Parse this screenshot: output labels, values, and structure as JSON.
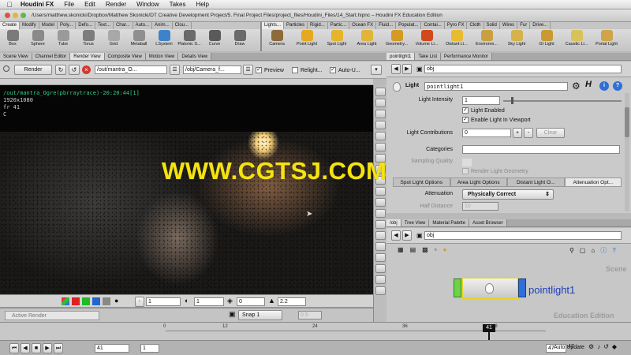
{
  "menubar": {
    "app": "Houdini FX",
    "items": [
      "File",
      "Edit",
      "Render",
      "Window",
      "Takes",
      "Help"
    ],
    "title": "/Users/matthew.skonicki/Dropbox/Matthew Skonicki/DT Creative Development Project/5. Final Project Files/project_files/Houdini_Files/14_Start.hipnc – Houdini FX Education Edition"
  },
  "shelf_left": {
    "tabs": [
      "Create",
      "Modify",
      "Model",
      "Poly...",
      "Defo...",
      "Text...",
      "Char...",
      "Auto...",
      "Anim...",
      "Clou..."
    ],
    "tools": [
      {
        "label": "Box",
        "color": "#7a7a7a"
      },
      {
        "label": "Sphere",
        "color": "#8a8a8a"
      },
      {
        "label": "Tube",
        "color": "#9a9a9a"
      },
      {
        "label": "Torus",
        "color": "#7d7d7d"
      },
      {
        "label": "Grid",
        "color": "#a8a8a8"
      },
      {
        "label": "Metaball",
        "color": "#8f8f8f"
      },
      {
        "label": "LSystem",
        "color": "#3d83c9"
      },
      {
        "label": "Platonic S...",
        "color": "#6a6a6a"
      },
      {
        "label": "Curve",
        "color": "#5a5a5a"
      },
      {
        "label": "Draw",
        "color": "#6a6a6a"
      }
    ]
  },
  "shelf_right": {
    "tabs": [
      "Lights...",
      "Particles",
      "Rigid...",
      "Partic...",
      "Ocean FX",
      "Fluid...",
      "Populat...",
      "Contai...",
      "Pyro FX",
      "Cloth",
      "Solid",
      "Wires",
      "Fur",
      "Drive..."
    ],
    "tools": [
      {
        "label": "Camera",
        "color": "#8c6a3a"
      },
      {
        "label": "Point Light",
        "color": "#e6a81e"
      },
      {
        "label": "Spot Light",
        "color": "#e6b42a"
      },
      {
        "label": "Area Light",
        "color": "#e2b538"
      },
      {
        "label": "Geometry...",
        "color": "#d59a24"
      },
      {
        "label": "Volume Li...",
        "color": "#d24a1c"
      },
      {
        "label": "Distant Li...",
        "color": "#e8bb30"
      },
      {
        "label": "Environm...",
        "color": "#c9a040"
      },
      {
        "label": "Sky Light",
        "color": "#d6b24c"
      },
      {
        "label": "GI Light",
        "color": "#c99a30"
      },
      {
        "label": "Caustic Li...",
        "color": "#d9c25a"
      },
      {
        "label": "Portal Light",
        "color": "#cfa44a"
      }
    ]
  },
  "left_pane": {
    "tabs": [
      "Scene View",
      "Channel Editor",
      "Render View",
      "Composite View",
      "Motion View",
      "Details View"
    ],
    "active_tab": "Render View",
    "toolbar": {
      "render_label": "Render",
      "rop_path": "/out/mantra_O...",
      "camera_path": "/obj/Camera_f...",
      "preview_label": "Preview",
      "relight_label": "Relight...",
      "auto_update_label": "Auto-U..."
    },
    "viewer": {
      "line1": "/out/mantra_Ogre(pbrraytrace)-20:20:44[1]",
      "line2": "1920x1080",
      "line3": "fr 41",
      "line4": "C"
    },
    "bottom_bar": {
      "field1": "1",
      "field2": "1",
      "field3": "0",
      "field4": "2.2",
      "active_render": "Active Render",
      "snap_label": "Snap",
      "snap_value": "1",
      "dim_value": "0.5"
    }
  },
  "param_pane": {
    "tabs": [
      "pointlight1",
      "Take List",
      "Performance Monitor"
    ],
    "path": "obj",
    "node_type": "Light",
    "node_name": "pointlight1",
    "params": {
      "light_intensity_label": "Light Intensity",
      "light_intensity": "1",
      "light_enabled_label": "Light Enabled",
      "enable_viewport_label": "Enable Light In Viewport",
      "light_contributions_label": "Light Contributions",
      "light_contributions": "0",
      "clear_label": "Clear",
      "categories_label": "Categories",
      "sampling_quality_label": "Sampling Quality",
      "render_light_geo_label": "Render Light Geometry",
      "attenuation_label": "Attenuation",
      "attenuation_value": "Physically Correct",
      "half_distance_label": "Half Distance",
      "half_distance_value": "10"
    },
    "subtabs": [
      "Spot Light Options",
      "Area Light Options",
      "Distant Light O...",
      "Attenuation Opt..."
    ]
  },
  "network_pane": {
    "tabs": [
      "/obj",
      "Tree View",
      "Material Palette",
      "Asset Browser"
    ],
    "path": "obj",
    "context_label": "Scene",
    "edition_label": "Education Edition",
    "node_label": "pointlight1"
  },
  "timeline": {
    "ticks": [
      "0",
      "12",
      "24",
      "36",
      "48"
    ],
    "current_frame": "41",
    "start_frame": "1",
    "frame_field": "41",
    "end_frame": "47",
    "range_end": "47",
    "auto_update_label": "Auto Update"
  },
  "watermark": "WWW.CGTSJ.COM",
  "colors": {
    "accent_yellow": "#f5e211",
    "node_green": "#6fd34a",
    "node_blue": "#2f6fd6",
    "viewer_text_green": "#2fd08a"
  }
}
